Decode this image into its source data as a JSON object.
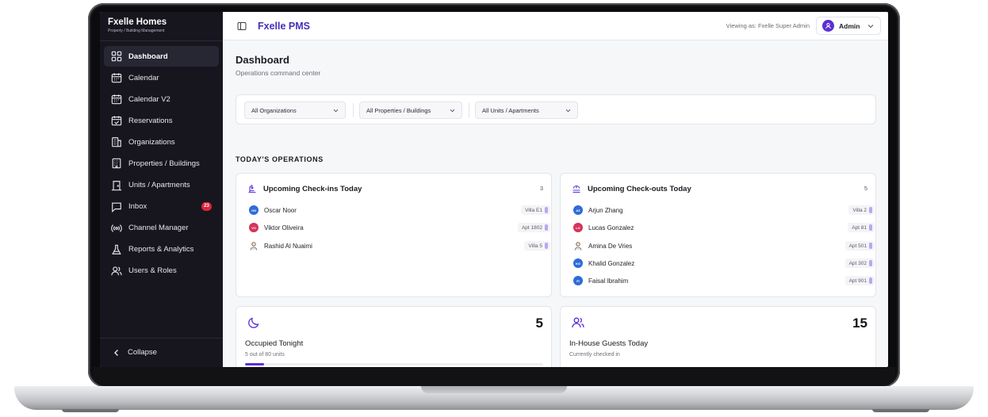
{
  "brand": {
    "name": "Fxelle Homes",
    "subtitle": "Property / Building Management"
  },
  "sidebar": {
    "items": [
      {
        "label": "Dashboard",
        "icon": "dashboard-icon",
        "active": true
      },
      {
        "label": "Calendar",
        "icon": "calendar-icon"
      },
      {
        "label": "Calendar V2",
        "icon": "calendar-icon"
      },
      {
        "label": "Reservations",
        "icon": "calendar-check-icon"
      },
      {
        "label": "Organizations",
        "icon": "building-icon"
      },
      {
        "label": "Properties / Buildings",
        "icon": "building-icon"
      },
      {
        "label": "Units / Apartments",
        "icon": "door-icon"
      },
      {
        "label": "Inbox",
        "icon": "message-icon",
        "badge": "23"
      },
      {
        "label": "Channel Manager",
        "icon": "broadcast-icon"
      },
      {
        "label": "Reports & Analytics",
        "icon": "flask-icon"
      },
      {
        "label": "Users & Roles",
        "icon": "users-icon"
      }
    ],
    "collapse_label": "Collapse"
  },
  "topbar": {
    "app_title": "Fxelle PMS",
    "viewing_as": "Viewing as: Fxelle Super Admin",
    "user_name": "Admin"
  },
  "page": {
    "title": "Dashboard",
    "subtitle": "Operations command center"
  },
  "filters": {
    "organizations": "All Organizations",
    "properties": "All Properties / Buildings",
    "units": "All Units / Apartments"
  },
  "operations": {
    "section_title": "TODAY'S OPERATIONS",
    "checkins": {
      "title": "Upcoming Check-ins Today",
      "count": "3",
      "guests": [
        {
          "initials": "ON",
          "name": "Oscar Noor",
          "unit": "Villa E1",
          "color": "#2f6bd8"
        },
        {
          "initials": "VO",
          "name": "Viktor Oliveira",
          "unit": "Apt 1802",
          "color": "#d6335a"
        },
        {
          "initials": "",
          "name": "Rashid Al Nuaimi",
          "unit": "Villa 5",
          "color": "#ffffff"
        }
      ]
    },
    "checkouts": {
      "title": "Upcoming Check-outs Today",
      "count": "5",
      "guests": [
        {
          "initials": "AZ",
          "name": "Arjun Zhang",
          "unit": "Villa 2",
          "color": "#2f6bd8"
        },
        {
          "initials": "LG",
          "name": "Lucas Gonzalez",
          "unit": "Apt 81",
          "color": "#d6335a"
        },
        {
          "initials": "",
          "name": "Amina De Vries",
          "unit": "Apt 501",
          "color": "#ffffff"
        },
        {
          "initials": "KG",
          "name": "Khalid Gonzalez",
          "unit": "Apt 302",
          "color": "#2f6bd8"
        },
        {
          "initials": "FI",
          "name": "Faisal Ibrahim",
          "unit": "Apt 901",
          "color": "#2f6bd8"
        }
      ]
    }
  },
  "stats": {
    "occupied": {
      "value": "5",
      "label": "Occupied Tonight",
      "sub": "5 out of 80 units",
      "progress_fraction": 0.0625
    },
    "inhouse": {
      "value": "15",
      "label": "In-House Guests Today",
      "sub": "Currently checked in"
    }
  },
  "colors": {
    "accent": "#5b2fd6",
    "brand_title": "#4530b8",
    "sidebar_bg": "#17161f",
    "badge": "#e0243a"
  }
}
